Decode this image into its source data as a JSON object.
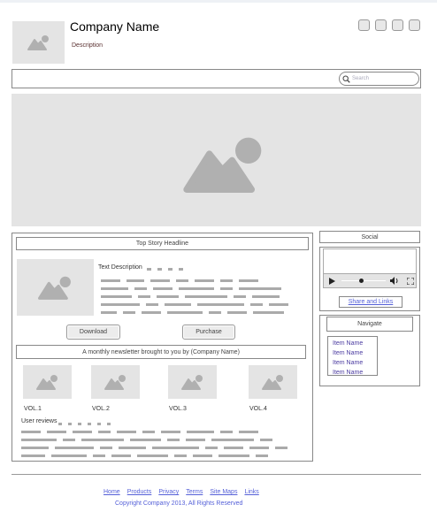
{
  "header": {
    "company_name": "Company Name",
    "description": "Description",
    "window_buttons": 4
  },
  "nav": {
    "search_placeholder": "Search",
    "search_icon": "search-icon"
  },
  "main": {
    "headline": "Top Story Headline",
    "text_description": "Text Description",
    "download_label": "Download",
    "purchase_label": "Purchase",
    "newsletter": "A monthly newsletter brought to you by (Company Name)",
    "volumes": [
      {
        "label": "VOL.1"
      },
      {
        "label": "VOL.2"
      },
      {
        "label": "VOL.3"
      },
      {
        "label": "VOL.4"
      }
    ],
    "user_reviews": "User reviews"
  },
  "sidebar": {
    "social": "Social",
    "share_links": "Share and Links",
    "navigate": "Navigate",
    "items": [
      "Item Name",
      "Item Name",
      "Item Name",
      "Item Name"
    ]
  },
  "footer": {
    "links": [
      "Home",
      "Products",
      "Privacy",
      "Terms",
      "Site Maps",
      "Links"
    ],
    "copyright": "Copyright Company 2013, All Rights Reserved"
  },
  "colors": {
    "placeholder": "#e4e4e4",
    "icon": "#b0b0b0",
    "link": "#5560d8",
    "border": "#888888"
  }
}
